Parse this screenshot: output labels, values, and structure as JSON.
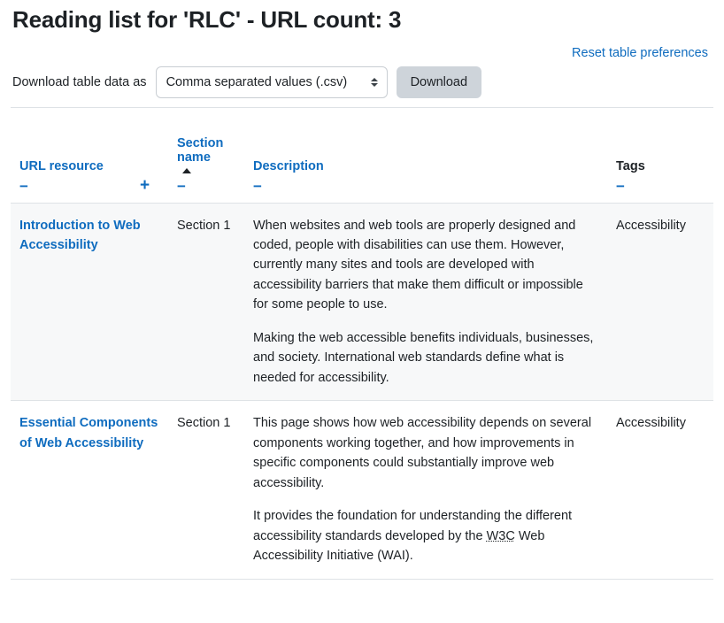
{
  "page": {
    "title": "Reading list for 'RLC' - URL count: 3"
  },
  "toolbar": {
    "reset_link": "Reset table preferences",
    "download_label": "Download table data as",
    "format_selected": "Comma separated values (.csv)",
    "download_button": "Download"
  },
  "table": {
    "headers": {
      "url_resource": "URL resource",
      "section_name": "Section name",
      "description": "Description",
      "tags": "Tags"
    },
    "controls": {
      "collapse": "−",
      "expand": "+",
      "sort_ascending_icon": "sort-asc-icon"
    },
    "rows": [
      {
        "url_resource": "Introduction to Web Accessibility",
        "section_name": "Section 1",
        "description_paragraphs": [
          "When websites and web tools are properly designed and coded, people with disabilities can use them. However, currently many sites and tools are developed with accessibility barriers that make them difficult or impossible for some people to use.",
          "Making the web accessible benefits individuals, businesses, and society. International web standards define what is needed for accessibility."
        ],
        "tags": "Accessibility"
      },
      {
        "url_resource": "Essential Components of Web Accessibility",
        "section_name": "Section 1",
        "description_paragraphs": [
          "This page shows how web accessibility depends on several components working together, and how improvements in specific components could substantially improve web accessibility.",
          "It provides the foundation for understanding the different accessibility standards developed by the "
        ],
        "description_abbr": "W3C",
        "description_tail": " Web Accessibility Initiative (WAI).",
        "tags": "Accessibility"
      }
    ]
  },
  "colors": {
    "link": "#0f6cbf",
    "text": "#1d2125",
    "row_alt_bg": "#f7f8f9",
    "border": "#dee2e6",
    "button_bg": "#ced4da"
  }
}
